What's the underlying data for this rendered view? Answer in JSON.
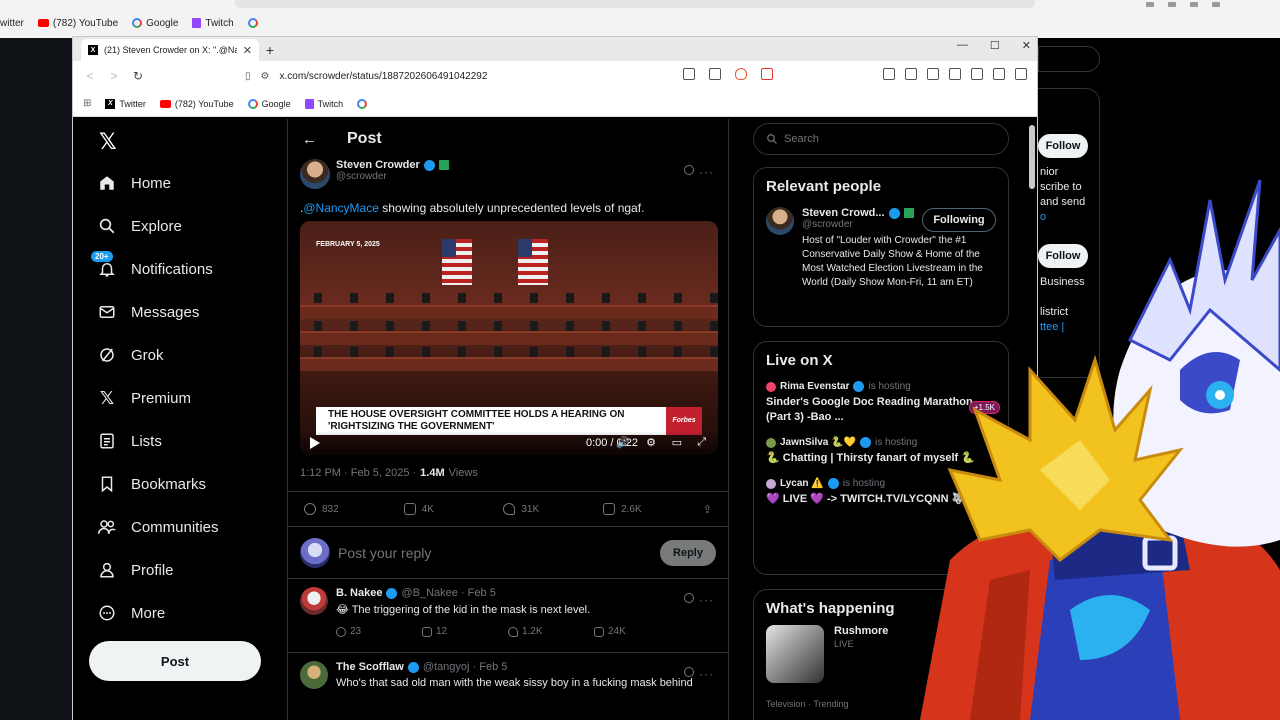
{
  "outer_bookmarks": [
    {
      "label": "witter",
      "icon": "x"
    },
    {
      "label": "(782) YouTube",
      "icon": "youtube"
    },
    {
      "label": "Google",
      "icon": "google"
    },
    {
      "label": "Twitch",
      "icon": "twitch"
    }
  ],
  "bg_right": {
    "follow_1": "Follow",
    "text_1": [
      "nior",
      "scribe to",
      "and send",
      "o"
    ],
    "follow_2": "Follow",
    "text_2": [
      "Business",
      "listrict",
      "ttee |"
    ]
  },
  "browser": {
    "tab_title": "(21) Steven Crowder on X: \".@Na",
    "url": "x.com/scrowder/status/1887202606491042292",
    "bookmarks": [
      {
        "label": "Twitter",
        "icon": "x"
      },
      {
        "label": "(782) YouTube",
        "icon": "youtube"
      },
      {
        "label": "Google",
        "icon": "google"
      },
      {
        "label": "Twitch",
        "icon": "twitch"
      }
    ]
  },
  "nav": {
    "items": [
      {
        "label": "Home",
        "icon": "home-icon"
      },
      {
        "label": "Explore",
        "icon": "search-icon"
      },
      {
        "label": "Notifications",
        "icon": "bell-icon",
        "badge": "20+"
      },
      {
        "label": "Messages",
        "icon": "mail-icon"
      },
      {
        "label": "Grok",
        "icon": "grok-icon"
      },
      {
        "label": "Premium",
        "icon": "x-icon"
      },
      {
        "label": "Lists",
        "icon": "list-icon"
      },
      {
        "label": "Bookmarks",
        "icon": "bookmark-icon"
      },
      {
        "label": "Communities",
        "icon": "people-icon"
      },
      {
        "label": "Profile",
        "icon": "person-icon"
      },
      {
        "label": "More",
        "icon": "more-icon"
      }
    ],
    "post_label": "Post"
  },
  "header": {
    "title": "Post"
  },
  "tweet": {
    "name": "Steven Crowder",
    "handle": "@scrowder",
    "text_prefix": ".",
    "mention": "@NancyMace",
    "text": " showing absolutely unprecedented levels of ngaf.",
    "video": {
      "date": "FEBRUARY 5, 2025",
      "banner_line1": "THE HOUSE OVERSIGHT COMMITTEE HOLDS A HEARING ON",
      "banner_line2": "'RIGHTSIZING THE GOVERNMENT'",
      "brand": "Forbes",
      "brand_sub": "BREAKING NEWS",
      "time": "0:00 / 0:22"
    },
    "time": "1:12 PM · Feb 5, 2025 ·",
    "views_count": "1.4M",
    "views_label": "Views",
    "replies": "832",
    "reposts": "4K",
    "likes": "31K",
    "bookmarks": "2.6K"
  },
  "reply_box": {
    "placeholder": "Post your reply",
    "button": "Reply"
  },
  "replies": [
    {
      "name": "B. Nakee",
      "handle": "@B_Nakee · Feb 5",
      "text": "😂 The triggering of the kid in the mask is next level.",
      "replies": "23",
      "reposts": "12",
      "likes": "1.2K",
      "views": "24K"
    },
    {
      "name": "The Scofflaw",
      "handle": "@tangyoj · Feb 5",
      "text": "Who's that sad old man with the weak sissy boy in a fucking mask behind"
    }
  ],
  "search": {
    "placeholder": "Search"
  },
  "relevant": {
    "title": "Relevant people",
    "name": "Steven Crowd...",
    "handle": "@scrowder",
    "button": "Following",
    "bio": "Host of \"Louder with Crowder\" the #1 Conservative Daily Show & Home of the Most Watched Election Livestream in the World (Daily Show Mon-Fri, 11 am ET)"
  },
  "live": {
    "title": "Live on X",
    "items": [
      {
        "host": "Rima Evenstar",
        "hosting": "is hosting",
        "title": "Sinder's Google Doc Reading Marathon (Part 3) -Bao ...",
        "count": "+1.5K"
      },
      {
        "host": "JawnSilva 🐍💛",
        "hosting": "is hosting",
        "title": "🐍 Chatting | Thirsty fanart of myself 🐍"
      },
      {
        "host": "Lycan ⚠️",
        "hosting": "is hosting",
        "title": "💜 LIVE 💜 -> TWITCH.TV/LYCQNN 🐺"
      }
    ]
  },
  "happening": {
    "title": "What's happening",
    "trend": "Rushmore",
    "trend_status": "LIVE",
    "next_label": "Television · Trending"
  },
  "colors": {
    "accent": "#1d9bf0",
    "bg": "#000000",
    "border": "#2f3336",
    "muted": "#71767b"
  }
}
